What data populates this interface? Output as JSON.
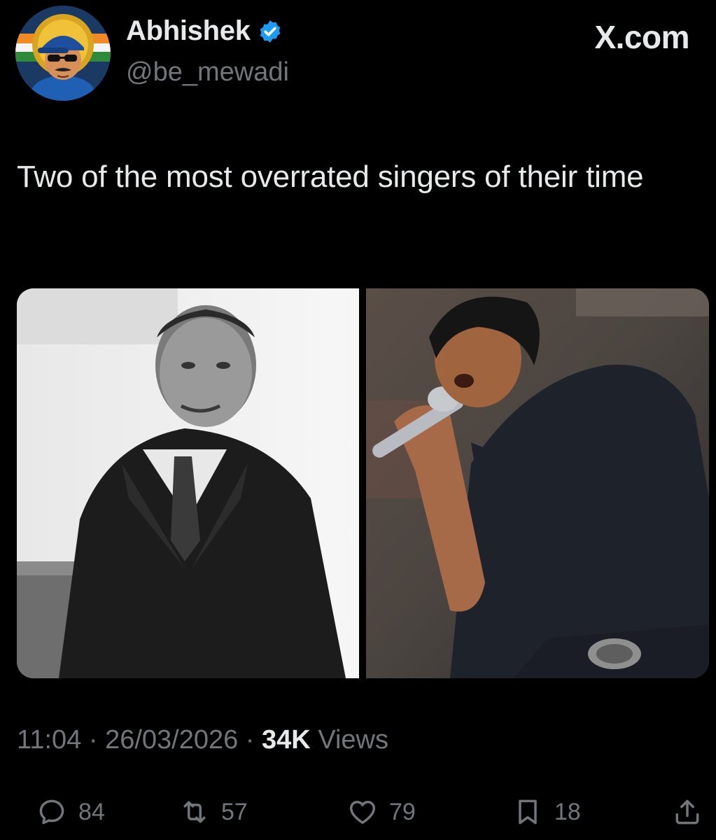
{
  "author": {
    "display_name": "Abhishek",
    "handle": "@be_mewadi",
    "verified": true,
    "avatar_icon": "cartoon-avatar-icon"
  },
  "brand": {
    "label": "X.com"
  },
  "tweet": {
    "text": "Two of the most overrated singers of their time",
    "media": [
      {
        "name": "photo-left",
        "kind": "black-and-white portrait"
      },
      {
        "name": "photo-right",
        "kind": "concert photo"
      }
    ]
  },
  "meta": {
    "time": "11:04",
    "separator": " · ",
    "date": "26/03/2026",
    "views_count": "34K",
    "views_label": "Views"
  },
  "actions": {
    "replies": "84",
    "retweets": "57",
    "likes": "79",
    "bookmarks": "18"
  },
  "colors": {
    "background": "#000000",
    "text": "#e7e9ea",
    "secondary": "#71767b",
    "verified": "#1d9bf0"
  }
}
